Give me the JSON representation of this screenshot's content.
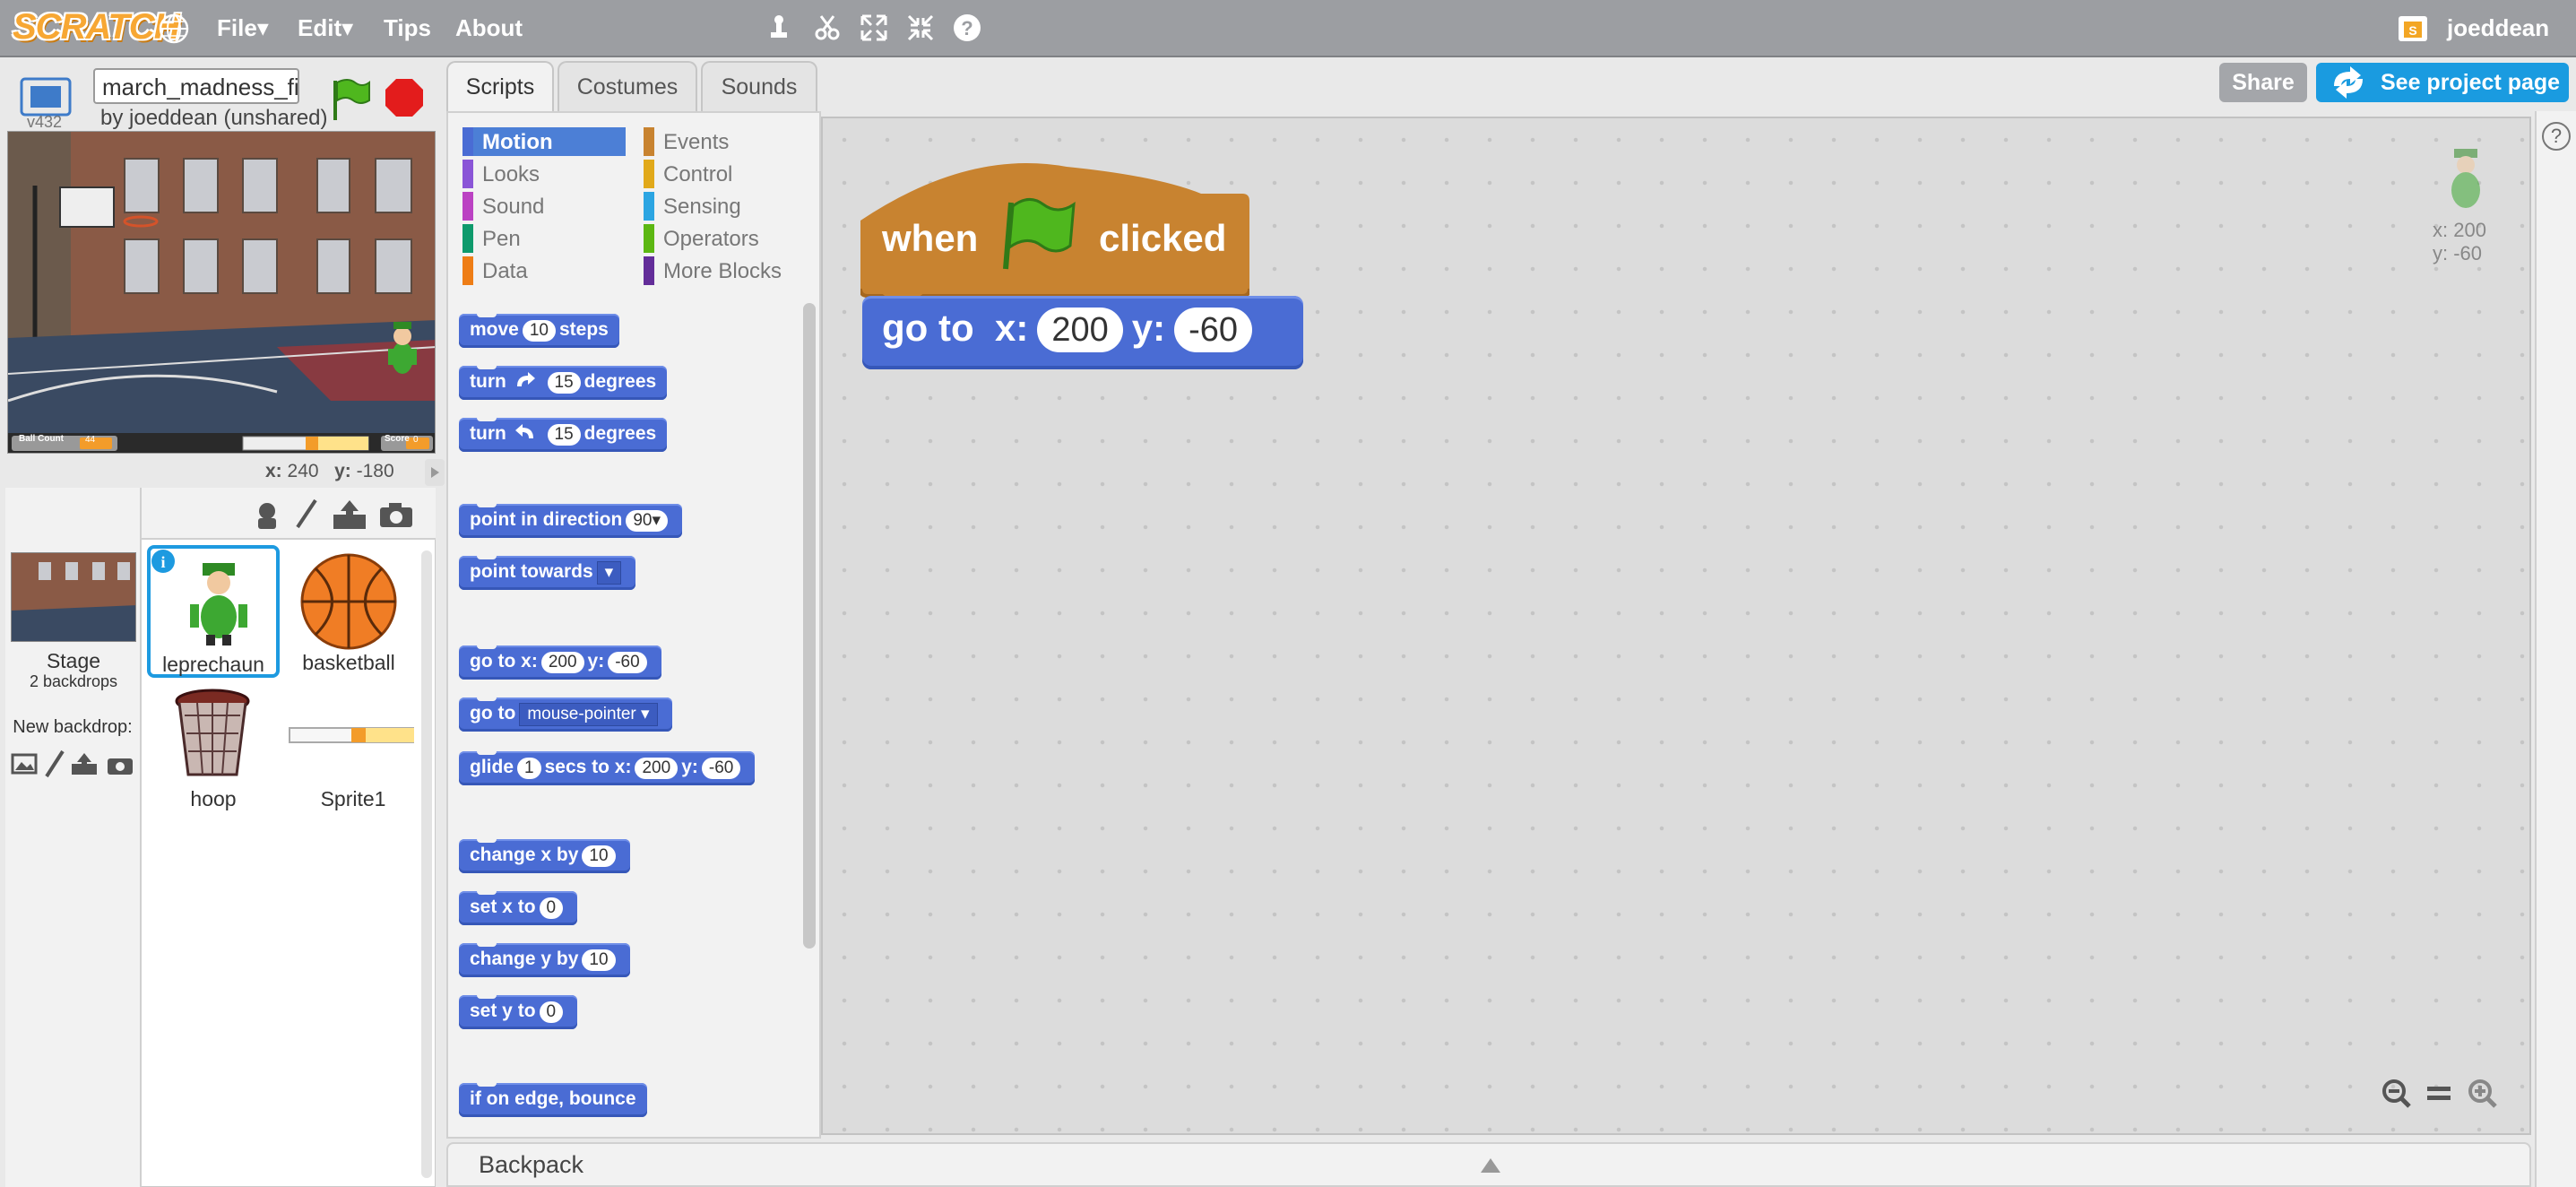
{
  "app": {
    "logo_text": "SCRATCH"
  },
  "menu": {
    "items": [
      "File▾",
      "Edit▾",
      "Tips",
      "About"
    ],
    "user": "joeddean"
  },
  "project": {
    "title": "march_madness_fi",
    "byline": "by joeddean (unshared)",
    "version": "v432"
  },
  "stage": {
    "coords": {
      "x_label": "x:",
      "x": "240",
      "y_label": "y:",
      "y": "-180"
    },
    "hud": {
      "ball_count_label": "Ball Count",
      "ball_count_value": "44",
      "score_label": "Score",
      "score_value": "0"
    }
  },
  "sprites": {
    "stage_label": "Stage",
    "backdrop_count": "2 backdrops",
    "new_backdrop": "New backdrop:",
    "items": [
      {
        "name": "leprechaun"
      },
      {
        "name": "basketball"
      },
      {
        "name": "hoop"
      },
      {
        "name": "Sprite1"
      }
    ]
  },
  "tabs": [
    "Scripts",
    "Costumes",
    "Sounds"
  ],
  "categories": {
    "left": [
      "Motion",
      "Looks",
      "Sound",
      "Pen",
      "Data"
    ],
    "right": [
      "Events",
      "Control",
      "Sensing",
      "Operators",
      "More Blocks"
    ],
    "colors": {
      "Motion": "#4a6cd4",
      "Looks": "#8a55d7",
      "Sound": "#bb42c3",
      "Pen": "#0e9a6c",
      "Data": "#ee7d16",
      "Events": "#c88330",
      "Control": "#e1a91a",
      "Sensing": "#2ca5e2",
      "Operators": "#5cb712",
      "More Blocks": "#632d99"
    }
  },
  "blocks": {
    "move": [
      "move",
      "10",
      "steps"
    ],
    "turn_right": [
      "turn",
      "15",
      "degrees"
    ],
    "turn_left": [
      "turn",
      "15",
      "degrees"
    ],
    "point_dir": [
      "point in direction",
      "90▾"
    ],
    "point_towards": [
      "point towards",
      "▾"
    ],
    "goto_xy": [
      "go to x:",
      "200",
      "y:",
      "-60"
    ],
    "goto": [
      "go to",
      "mouse-pointer ▾"
    ],
    "glide": [
      "glide",
      "1",
      "secs to x:",
      "200",
      "y:",
      "-60"
    ],
    "change_x": [
      "change x by",
      "10"
    ],
    "set_x": [
      "set x to",
      "0"
    ],
    "change_y": [
      "change y by",
      "10"
    ],
    "set_y": [
      "set y to",
      "0"
    ],
    "bounce": [
      "if on edge, bounce"
    ]
  },
  "script": {
    "hat_when": "when",
    "hat_clicked": "clicked",
    "goto": "go to",
    "x_label": "x:",
    "x": "200",
    "y_label": "y:",
    "y": "-60"
  },
  "sprite_info": {
    "x": "x: 200",
    "y": "y: -60"
  },
  "buttons": {
    "share": "Share",
    "see_project": "See project page"
  },
  "backpack": "Backpack",
  "help": "?"
}
